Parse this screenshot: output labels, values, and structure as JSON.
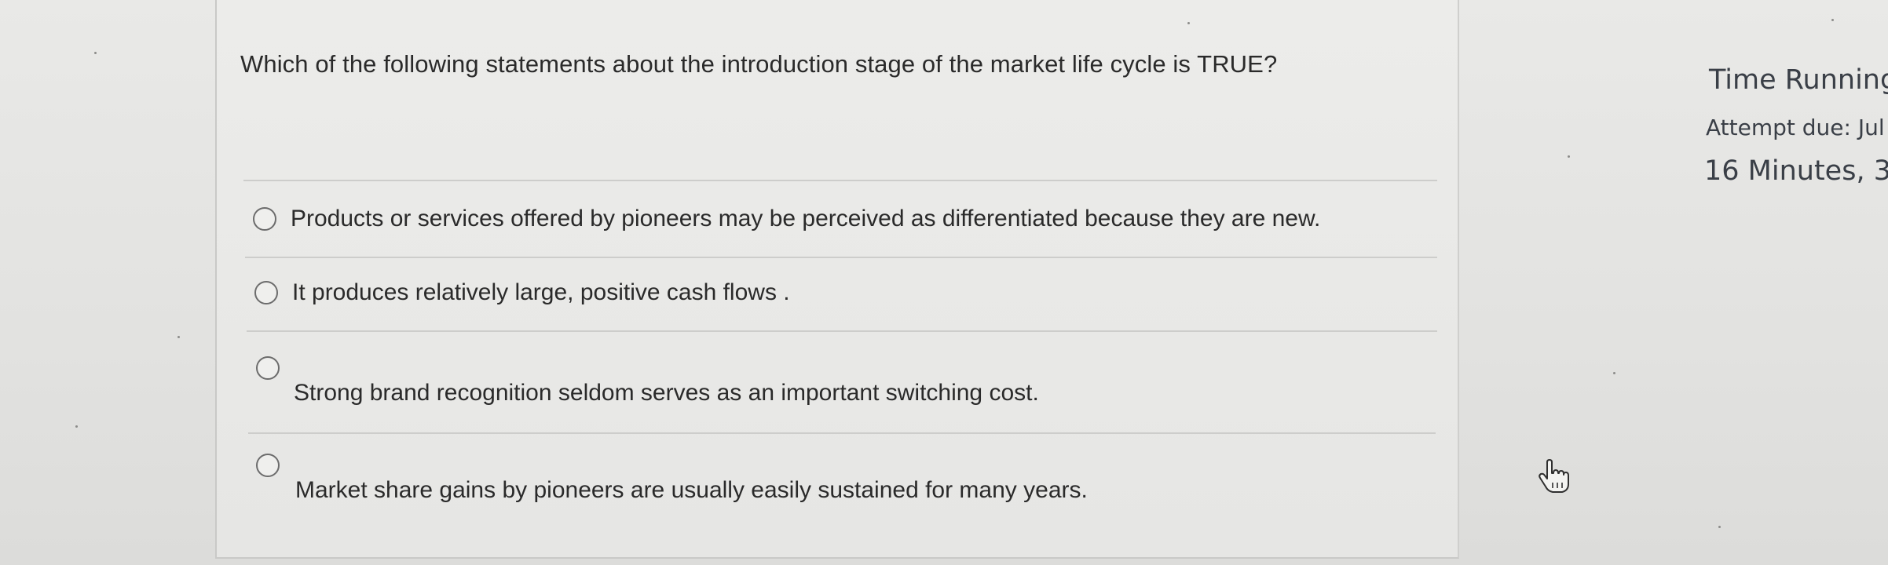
{
  "question": {
    "text": "Which of the following statements about the introduction stage of the market life cycle is TRUE?"
  },
  "answers": [
    {
      "label": "Products or services offered by pioneers may be perceived as differentiated because they are new.",
      "selected": false
    },
    {
      "label": "It produces relatively large, positive cash flows .",
      "selected": false
    },
    {
      "label": "Strong brand recognition seldom serves as an important switching cost.",
      "selected": false
    },
    {
      "label": "Market share gains by pioneers are usually easily sustained for many years.",
      "selected": false
    }
  ],
  "timer": {
    "title": "Time Running",
    "attempt_due": "Attempt due: Jul",
    "time_left": "16 Minutes, 3"
  },
  "icons": {
    "cursor": "hand-pointer-icon",
    "radio": "radio-button-icon"
  },
  "colors": {
    "background": "#e4e4e2",
    "text": "#2a2a2a",
    "timer_text": "#3a3f47"
  }
}
